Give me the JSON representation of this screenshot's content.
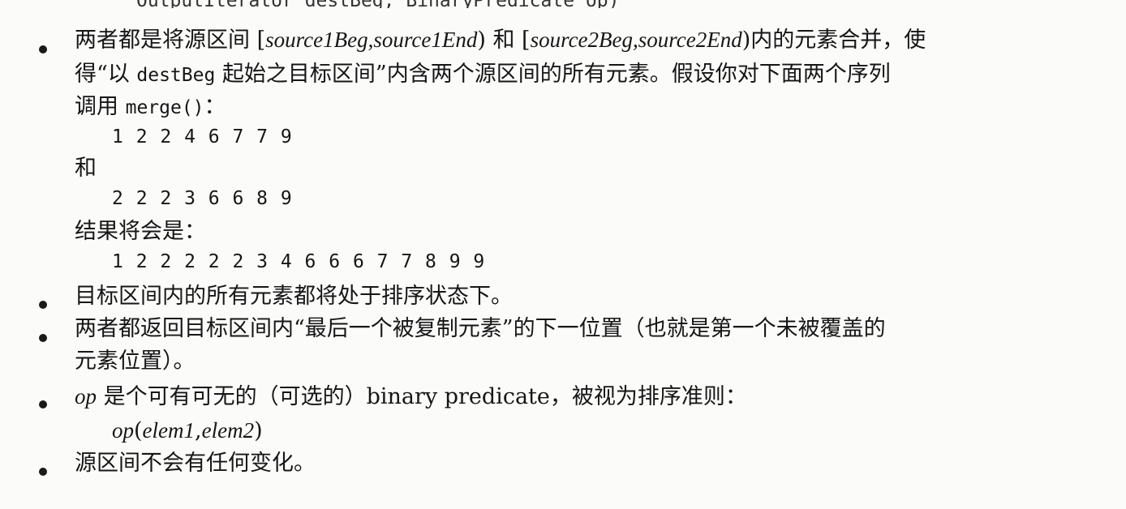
{
  "top_cut_line": "OutputIterator destBeg, BinaryPredicate op)",
  "bullets": [
    {
      "line1": {
        "a": "两者都是将源区间 [",
        "b": "source1Beg",
        "c": ",",
        "d": "source1End",
        "e": ") 和 [",
        "f": "source2Beg",
        "g": ",",
        "h": "source2End",
        "i": ")内的元素合并，使"
      },
      "line2": {
        "a": "得“以 ",
        "b": "destBeg",
        "c": " 起始之目标区间”内含两个源区间的所有元素。假设你对下面两个序列"
      },
      "line3": {
        "a": "调用 ",
        "b": "merge()",
        "c": "："
      },
      "seq1": "1 2 2 4 6 7 7 9",
      "and": "和",
      "seq2": "2 2 2 3 6 6 8 9",
      "result_label": "结果将会是：",
      "result": "1 2 2 2 2 2 3 4 6 6 6 7 7 8 9 9"
    },
    {
      "text": "目标区间内的所有元素都将处于排序状态下。"
    },
    {
      "line1": "两者都返回目标区间内“最后一个被复制元素”的下一位置（也就是第一个未被覆盖的",
      "line2": "元素位置）。"
    },
    {
      "line1": {
        "a": "op",
        "b": " 是个可有可无的（可选的）binary predicate，被视为排序准则："
      },
      "line2": {
        "a": "op",
        "b": "(",
        "c": "elem1",
        "d": ",",
        "e": "elem2",
        "f": ")"
      }
    },
    {
      "text": "源区间不会有任何变化。"
    }
  ]
}
